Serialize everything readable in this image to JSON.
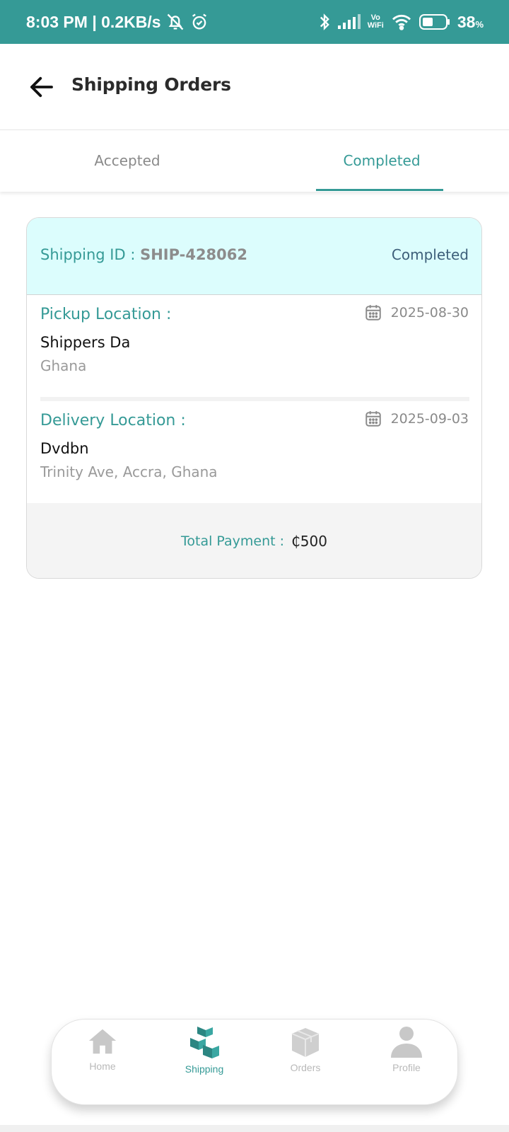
{
  "status_bar": {
    "time_speed": "8:03 PM | 0.2KB/s",
    "vowifi_top": "Vo",
    "vowifi_bottom": "WiFi",
    "battery": "38",
    "battery_unit": "%"
  },
  "header": {
    "title": "Shipping Orders"
  },
  "tabs": [
    {
      "label": "Accepted",
      "active": false
    },
    {
      "label": "Completed",
      "active": true
    }
  ],
  "order": {
    "id_label": "Shipping ID : ",
    "id_value": "SHIP-428062",
    "status": "Completed",
    "pickup": {
      "label": "Pickup Location :",
      "date": "2025-08-30",
      "name": "Shippers Da",
      "address": "Ghana"
    },
    "delivery": {
      "label": "Delivery Location :",
      "date": "2025-09-03",
      "name": "Dvdbn",
      "address": "Trinity Ave, Accra, Ghana"
    },
    "payment_label": "Total Payment :",
    "payment_value": "₵500"
  },
  "bottom_nav": [
    {
      "label": "Home",
      "icon": "home-icon",
      "active": false
    },
    {
      "label": "Shipping",
      "icon": "boxes-icon",
      "active": true
    },
    {
      "label": "Orders",
      "icon": "package-icon",
      "active": false
    },
    {
      "label": "Profile",
      "icon": "person-icon",
      "active": false
    }
  ],
  "colors": {
    "accent": "#359a96",
    "card_header_bg": "#dcfdfd",
    "status_text": "#3d5f7a",
    "muted": "#9a9a9a"
  }
}
